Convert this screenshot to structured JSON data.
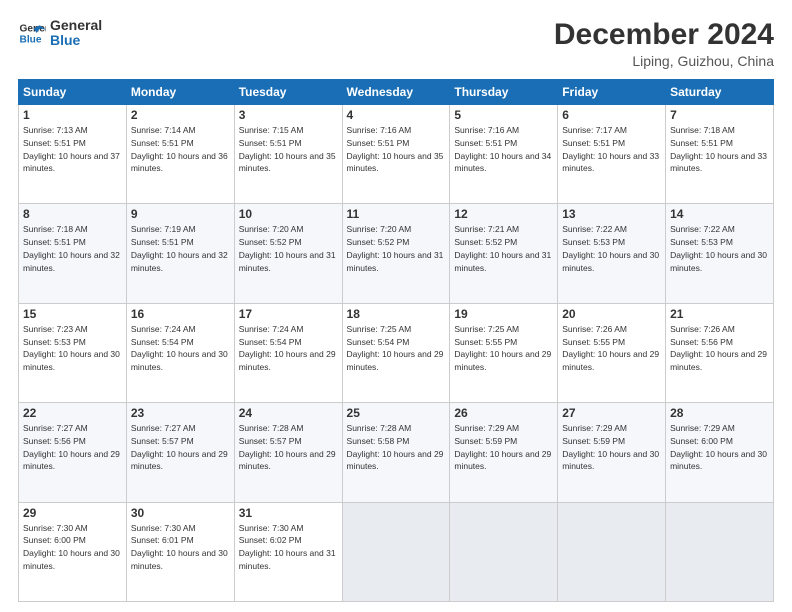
{
  "header": {
    "logo_line1": "General",
    "logo_line2": "Blue",
    "month": "December 2024",
    "location": "Liping, Guizhou, China"
  },
  "weekdays": [
    "Sunday",
    "Monday",
    "Tuesday",
    "Wednesday",
    "Thursday",
    "Friday",
    "Saturday"
  ],
  "weeks": [
    [
      {
        "day": "1",
        "sunrise": "7:13 AM",
        "sunset": "5:51 PM",
        "daylight": "10 hours and 37 minutes."
      },
      {
        "day": "2",
        "sunrise": "7:14 AM",
        "sunset": "5:51 PM",
        "daylight": "10 hours and 36 minutes."
      },
      {
        "day": "3",
        "sunrise": "7:15 AM",
        "sunset": "5:51 PM",
        "daylight": "10 hours and 35 minutes."
      },
      {
        "day": "4",
        "sunrise": "7:16 AM",
        "sunset": "5:51 PM",
        "daylight": "10 hours and 35 minutes."
      },
      {
        "day": "5",
        "sunrise": "7:16 AM",
        "sunset": "5:51 PM",
        "daylight": "10 hours and 34 minutes."
      },
      {
        "day": "6",
        "sunrise": "7:17 AM",
        "sunset": "5:51 PM",
        "daylight": "10 hours and 33 minutes."
      },
      {
        "day": "7",
        "sunrise": "7:18 AM",
        "sunset": "5:51 PM",
        "daylight": "10 hours and 33 minutes."
      }
    ],
    [
      {
        "day": "8",
        "sunrise": "7:18 AM",
        "sunset": "5:51 PM",
        "daylight": "10 hours and 32 minutes."
      },
      {
        "day": "9",
        "sunrise": "7:19 AM",
        "sunset": "5:51 PM",
        "daylight": "10 hours and 32 minutes."
      },
      {
        "day": "10",
        "sunrise": "7:20 AM",
        "sunset": "5:52 PM",
        "daylight": "10 hours and 31 minutes."
      },
      {
        "day": "11",
        "sunrise": "7:20 AM",
        "sunset": "5:52 PM",
        "daylight": "10 hours and 31 minutes."
      },
      {
        "day": "12",
        "sunrise": "7:21 AM",
        "sunset": "5:52 PM",
        "daylight": "10 hours and 31 minutes."
      },
      {
        "day": "13",
        "sunrise": "7:22 AM",
        "sunset": "5:53 PM",
        "daylight": "10 hours and 30 minutes."
      },
      {
        "day": "14",
        "sunrise": "7:22 AM",
        "sunset": "5:53 PM",
        "daylight": "10 hours and 30 minutes."
      }
    ],
    [
      {
        "day": "15",
        "sunrise": "7:23 AM",
        "sunset": "5:53 PM",
        "daylight": "10 hours and 30 minutes."
      },
      {
        "day": "16",
        "sunrise": "7:24 AM",
        "sunset": "5:54 PM",
        "daylight": "10 hours and 30 minutes."
      },
      {
        "day": "17",
        "sunrise": "7:24 AM",
        "sunset": "5:54 PM",
        "daylight": "10 hours and 29 minutes."
      },
      {
        "day": "18",
        "sunrise": "7:25 AM",
        "sunset": "5:54 PM",
        "daylight": "10 hours and 29 minutes."
      },
      {
        "day": "19",
        "sunrise": "7:25 AM",
        "sunset": "5:55 PM",
        "daylight": "10 hours and 29 minutes."
      },
      {
        "day": "20",
        "sunrise": "7:26 AM",
        "sunset": "5:55 PM",
        "daylight": "10 hours and 29 minutes."
      },
      {
        "day": "21",
        "sunrise": "7:26 AM",
        "sunset": "5:56 PM",
        "daylight": "10 hours and 29 minutes."
      }
    ],
    [
      {
        "day": "22",
        "sunrise": "7:27 AM",
        "sunset": "5:56 PM",
        "daylight": "10 hours and 29 minutes."
      },
      {
        "day": "23",
        "sunrise": "7:27 AM",
        "sunset": "5:57 PM",
        "daylight": "10 hours and 29 minutes."
      },
      {
        "day": "24",
        "sunrise": "7:28 AM",
        "sunset": "5:57 PM",
        "daylight": "10 hours and 29 minutes."
      },
      {
        "day": "25",
        "sunrise": "7:28 AM",
        "sunset": "5:58 PM",
        "daylight": "10 hours and 29 minutes."
      },
      {
        "day": "26",
        "sunrise": "7:29 AM",
        "sunset": "5:59 PM",
        "daylight": "10 hours and 29 minutes."
      },
      {
        "day": "27",
        "sunrise": "7:29 AM",
        "sunset": "5:59 PM",
        "daylight": "10 hours and 30 minutes."
      },
      {
        "day": "28",
        "sunrise": "7:29 AM",
        "sunset": "6:00 PM",
        "daylight": "10 hours and 30 minutes."
      }
    ],
    [
      {
        "day": "29",
        "sunrise": "7:30 AM",
        "sunset": "6:00 PM",
        "daylight": "10 hours and 30 minutes."
      },
      {
        "day": "30",
        "sunrise": "7:30 AM",
        "sunset": "6:01 PM",
        "daylight": "10 hours and 30 minutes."
      },
      {
        "day": "31",
        "sunrise": "7:30 AM",
        "sunset": "6:02 PM",
        "daylight": "10 hours and 31 minutes."
      },
      null,
      null,
      null,
      null
    ]
  ]
}
